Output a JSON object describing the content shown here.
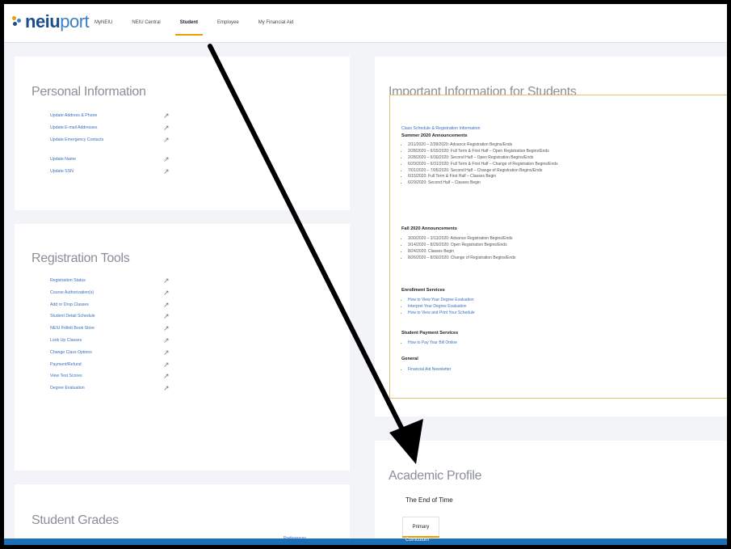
{
  "header": {
    "logo_bold": "neiu",
    "logo_light": "port",
    "nav": [
      "MyNEIU",
      "NEIU Central",
      "Student",
      "Employee",
      "My Financial Aid"
    ],
    "active_nav": "Student"
  },
  "personal_info": {
    "title": "Personal Information",
    "links": [
      "Update Address & Phone",
      "Update E-mail Addresses",
      "Update Emergency Contacts",
      "Update Name",
      "Update SSN"
    ]
  },
  "registration_tools": {
    "title": "Registration Tools",
    "links": [
      "Registration Status",
      "Course Authorization(s)",
      "Add or Drop Classes",
      "Student Detail Schedule",
      "NEIU Follett Book Store",
      "Look Up Classes",
      "Change Class Options",
      "Payment/Refund",
      "View Test Scores",
      "Degree Evaluation"
    ]
  },
  "student_grades": {
    "title": "Student Grades",
    "link": "Preferences"
  },
  "important_info": {
    "title": "Important Information for Students",
    "top_link": "Class Schedule & Registration Information",
    "summer_heading": "Summer 2020 Announcements",
    "summer_items": [
      "2/11/2020 – 2/28/2020: Advance Registration Begins/Ends",
      "2/28/2020 – 6/15/2020: Full Term & First Half – Open Registration Begins/Ends",
      "2/28/2020 – 6/30/2020: Second Half – Open Registration Begins/Ends",
      "6/20/2020 – 6/31/2020: Full Term & First Half – Change of Registration Begins/Ends",
      "7/01/2020 – 7/05/2020: Second Half – Change of Registration Begins/Ends",
      "6/15/2020: Full Term & First Half – Classes Begin",
      "6/29/2020: Second Half – Classes Begin"
    ],
    "fall_heading": "Fall 2020 Announcements",
    "fall_items": [
      "3/30/2020 – 3/13/2020: Advance Registration Begins/Ends",
      "3/14/2020 – 8/29/2020: Open Registration Begins/Ends",
      "8/24/2020: Classes Begin",
      "8/26/2020 – 8/30/2020: Change of Registration Begins/Ends"
    ],
    "enrollment_heading": "Enrollment Services",
    "enrollment_items": [
      "How to View Your Degree Evaluation",
      "Interpret Your Degree Evaluation",
      "How to View and Print Your Schedule"
    ],
    "payment_heading": "Student Payment Services",
    "payment_items": [
      "How to Pay Your Bill Online"
    ],
    "general_heading": "General",
    "general_items": [
      "Financial Aid Newsletter"
    ]
  },
  "academic_profile": {
    "title": "Academic Profile",
    "name": "The End of Time",
    "tab": "Primary",
    "sub": "Curriculum"
  },
  "colors": {
    "accent": "#e8a000",
    "link": "#3b6fbf",
    "brand": "#1b4d8c",
    "arrow": "#000000"
  }
}
